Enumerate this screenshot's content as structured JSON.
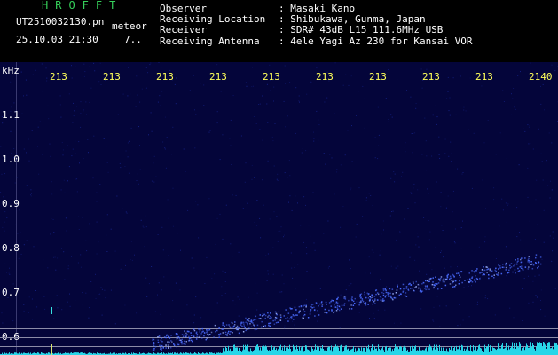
{
  "header": {
    "logo": "HROFFT",
    "filename": "UT2510032130.pn",
    "kind": "meteor",
    "datetime": "25.10.03 21:30",
    "count": "7..",
    "info": [
      {
        "key": "Observer",
        "value": ": Masaki Kano"
      },
      {
        "key": "Receiving Location",
        "value": ": Shibukawa, Gunma, Japan"
      },
      {
        "key": "Receiver",
        "value": ": SDR# 43dB L15 111.6MHz USB"
      },
      {
        "key": "Receiving Antenna",
        "value": ": 4ele Yagi Az 230 for Kansai VOR"
      }
    ]
  },
  "time_ticks": [
    "213",
    "213",
    "213",
    "213",
    "213",
    "213",
    "213",
    "213",
    "213",
    "2140"
  ],
  "y_axis": {
    "unit": "kHz",
    "labels": [
      "1.1",
      "1.0",
      "0.9",
      "0.8",
      "0.7",
      "0.6"
    ]
  },
  "colors": {
    "background": "#04053a",
    "trail": "#4a6cff",
    "noise_floor": "#27d6e8",
    "tick_text": "#ffff5a",
    "logo": "#35d05a"
  }
}
